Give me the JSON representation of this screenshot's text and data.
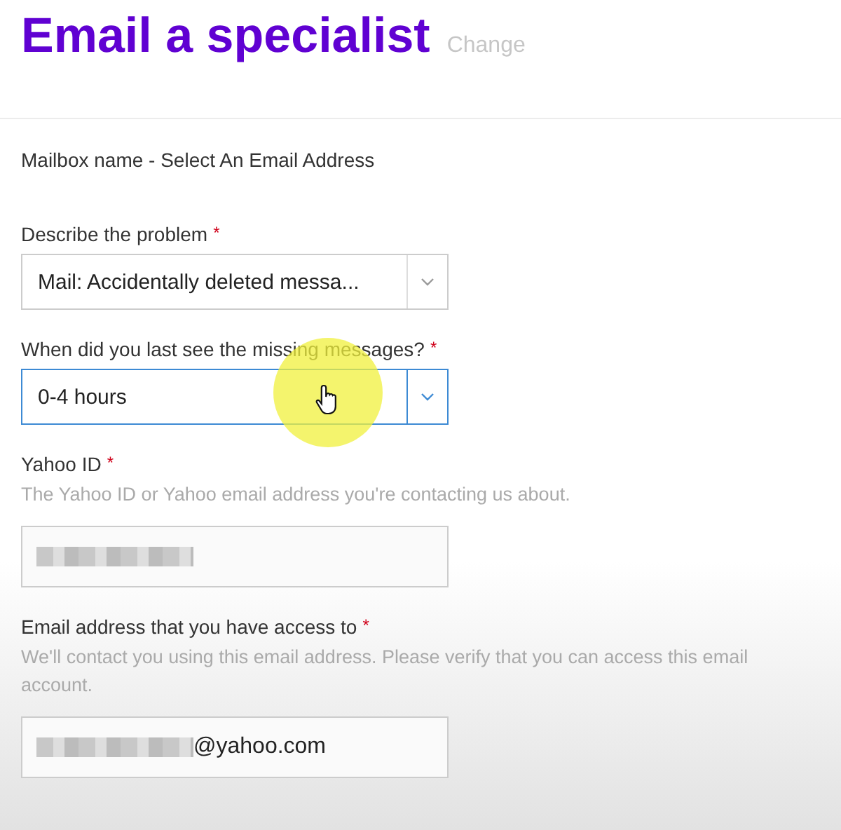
{
  "header": {
    "title": "Email a specialist",
    "link": "Change"
  },
  "mailbox": "Mailbox name - Select An Email Address",
  "fields": [
    {
      "kind": "select",
      "label": "Describe the problem",
      "required_mark": "*",
      "value": "Mail: Accidentally deleted messa...",
      "focused": false
    },
    {
      "kind": "select",
      "label": "When did you last see the missing messages?",
      "required_mark": "*",
      "value": "0-4 hours",
      "focused": true,
      "cursor": true
    },
    {
      "kind": "text",
      "label": "Yahoo ID",
      "required_mark": "*",
      "help": "The Yahoo ID or Yahoo email address you're contacting us about.",
      "redacted": true
    },
    {
      "kind": "text",
      "label": "Email address that you have access to",
      "required_mark": "*",
      "help": "We'll contact you using this email address. Please verify that you can access this email account.",
      "redacted": true,
      "value": "@yahoo.com"
    }
  ]
}
